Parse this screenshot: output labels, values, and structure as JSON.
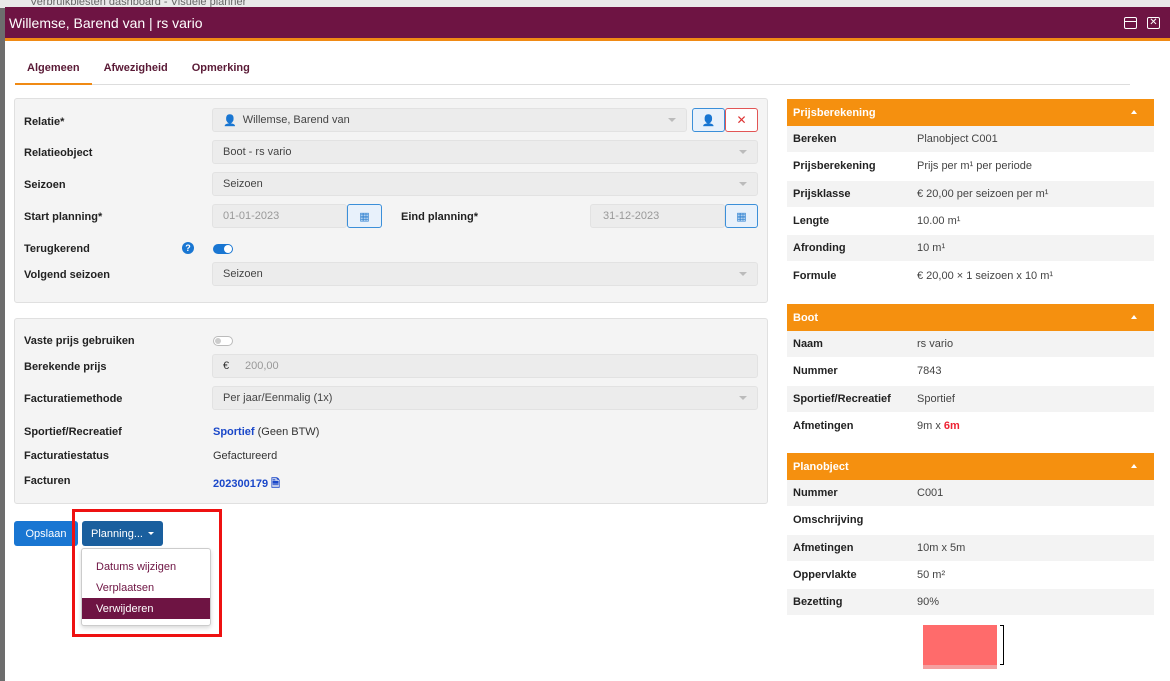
{
  "window": {
    "title": "Willemse, Barend van | rs vario",
    "bg_text": "Verbruikbiesten dashboard - Visuele planner"
  },
  "tabs": [
    {
      "label": "Algemeen",
      "active": true
    },
    {
      "label": "Afwezigheid",
      "active": false
    },
    {
      "label": "Opmerking",
      "active": false
    }
  ],
  "form": {
    "relatie_label": "Relatie*",
    "relatie_value": "Willemse, Barend van",
    "relatieobject_label": "Relatieobject",
    "relatieobject_value": "Boot - rs vario",
    "seizoen_label": "Seizoen",
    "seizoen_value": "Seizoen",
    "start_label": "Start planning*",
    "start_value": "01-01-2023",
    "eind_label": "Eind planning*",
    "eind_value": "31-12-2023",
    "terugkerend_label": "Terugkerend",
    "help_glyph": "?",
    "volgend_label": "Volgend seizoen",
    "volgend_value": "Seizoen"
  },
  "pricing": {
    "vaste_label": "Vaste prijs gebruiken",
    "berekende_label": "Berekende prijs",
    "currency": "€",
    "berekende_value": "200,00",
    "facturatiemethode_label": "Facturatiemethode",
    "facturatiemethode_value": "Per jaar/Eenmalig (1x)",
    "sport_label": "Sportief/Recreatief",
    "sport_value": "Sportief",
    "sport_note": "(Geen BTW)",
    "status_label": "Facturatiestatus",
    "status_value": "Gefactureerd",
    "facturen_label": "Facturen",
    "facturen_value": "202300179"
  },
  "actions": {
    "save": "Opslaan",
    "planning": "Planning...",
    "menu": [
      "Datums wijzigen",
      "Verplaatsen",
      "Verwijderen"
    ]
  },
  "side": {
    "prijs_title": "Prijsberekening",
    "prijs_rows": [
      {
        "k": "Bereken",
        "v": "Planobject C001"
      },
      {
        "k": "Prijsberekening",
        "v": "Prijs per m¹ per periode"
      },
      {
        "k": "Prijsklasse",
        "v": "€ 20,00 per seizoen per m¹"
      },
      {
        "k": "Lengte",
        "v": "10.00 m¹"
      },
      {
        "k": "Afronding",
        "v": "10 m¹"
      },
      {
        "k": "Formule",
        "v": "€ 20,00 × 1 seizoen x 10 m¹"
      }
    ],
    "boot_title": "Boot",
    "boot_rows": [
      {
        "k": "Naam",
        "v": "rs vario"
      },
      {
        "k": "Nummer",
        "v": "7843"
      },
      {
        "k": "Sportief/Recreatief",
        "v": "Sportief"
      }
    ],
    "boot_afm_label": "Afmetingen",
    "boot_afm_prefix": "9m x ",
    "boot_afm_red": "6m",
    "plan_title": "Planobject",
    "plan_rows": [
      {
        "k": "Nummer",
        "v": "C001"
      },
      {
        "k": "Omschrijving",
        "v": ""
      },
      {
        "k": "Afmetingen",
        "v": "10m x 5m"
      },
      {
        "k": "Oppervlakte",
        "v": "50 m²"
      },
      {
        "k": "Bezetting",
        "v": "90%"
      }
    ]
  },
  "colors": {
    "header": "#6e1443",
    "accent": "#f5900f",
    "primary": "#1976d2"
  }
}
